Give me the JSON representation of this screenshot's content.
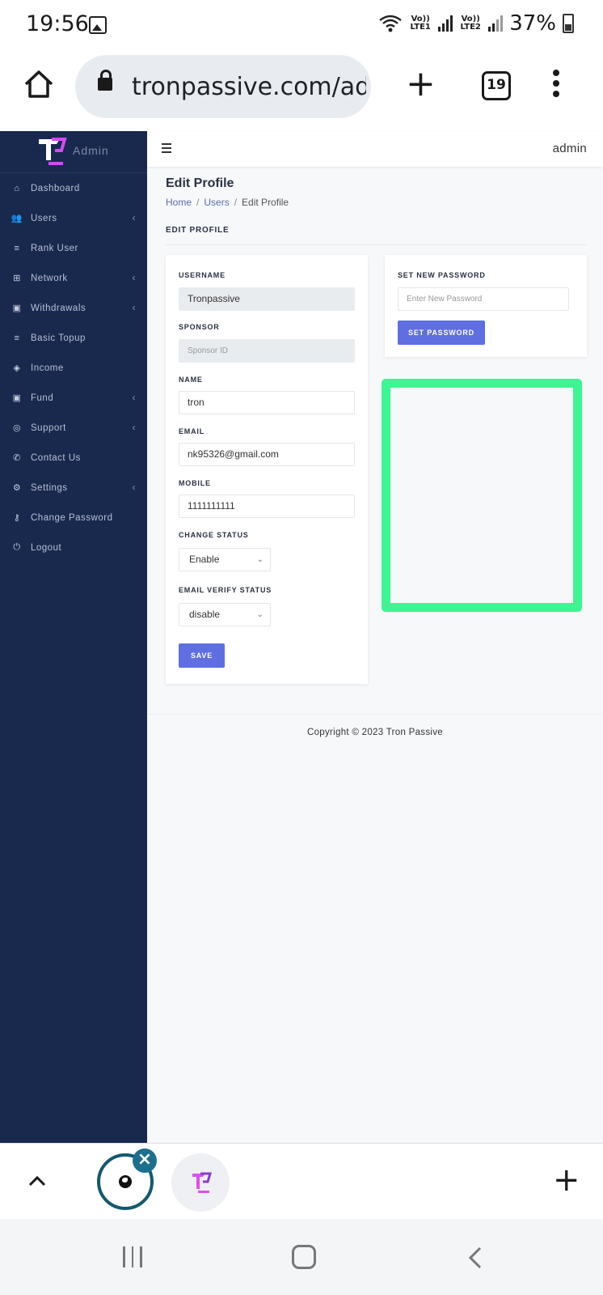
{
  "status_bar": {
    "time": "19:56",
    "sim1_label": "Vo)) LTE1",
    "sim2_label": "Vo)) LTE2",
    "battery": "37%"
  },
  "browser": {
    "url": "tronpassive.com/ad",
    "tab_count": "19"
  },
  "sidebar": {
    "brand": "Admin",
    "items": [
      {
        "label": "Dashboard",
        "icon": "home-icon",
        "has_submenu": false
      },
      {
        "label": "Users",
        "icon": "users-icon",
        "has_submenu": true
      },
      {
        "label": "Rank User",
        "icon": "list-icon",
        "has_submenu": false
      },
      {
        "label": "Network",
        "icon": "sitemap-icon",
        "has_submenu": true
      },
      {
        "label": "Withdrawals",
        "icon": "card-icon",
        "has_submenu": true
      },
      {
        "label": "Basic Topup",
        "icon": "list-icon",
        "has_submenu": false
      },
      {
        "label": "Income",
        "icon": "money-icon",
        "has_submenu": false
      },
      {
        "label": "Fund",
        "icon": "card-icon",
        "has_submenu": true
      },
      {
        "label": "Support",
        "icon": "lifering-icon",
        "has_submenu": true
      },
      {
        "label": "Contact Us",
        "icon": "phone-icon",
        "has_submenu": false
      },
      {
        "label": "Settings",
        "icon": "gear-icon",
        "has_submenu": true
      },
      {
        "label": "Change Password",
        "icon": "key-icon",
        "has_submenu": false
      },
      {
        "label": "Logout",
        "icon": "power-icon",
        "has_submenu": false
      }
    ]
  },
  "topbar": {
    "user": "admin"
  },
  "page": {
    "title": "Edit Profile",
    "breadcrumb": {
      "home": "Home",
      "users": "Users",
      "current": "Edit Profile",
      "separator": "/"
    },
    "section_title": "EDIT PROFILE"
  },
  "profile_form": {
    "username_label": "USERNAME",
    "username_value": "Tronpassive",
    "sponsor_label": "SPONSOR",
    "sponsor_placeholder": "Sponsor ID",
    "name_label": "NAME",
    "name_value": "tron",
    "email_label": "EMAIL",
    "email_value": "nk95326@gmail.com",
    "mobile_label": "MOBILE",
    "mobile_value": "1111111111",
    "change_status_label": "CHANGE STATUS",
    "change_status_value": "Enable",
    "email_verify_label": "EMAIL VERIFY STATUS",
    "email_verify_value": "disable",
    "save_label": "SAVE"
  },
  "password_form": {
    "title": "SET NEW PASSWORD",
    "placeholder": "Enter New Password",
    "button_label": "SET PASSWORD"
  },
  "footer": {
    "copyright": "Copyright © 2023 Tron Passive"
  },
  "colors": {
    "sidebar_bg": "#19294d",
    "primary_button": "#5f6ee0",
    "highlight_box": "#3cf593",
    "tab_ring": "#13596e"
  }
}
